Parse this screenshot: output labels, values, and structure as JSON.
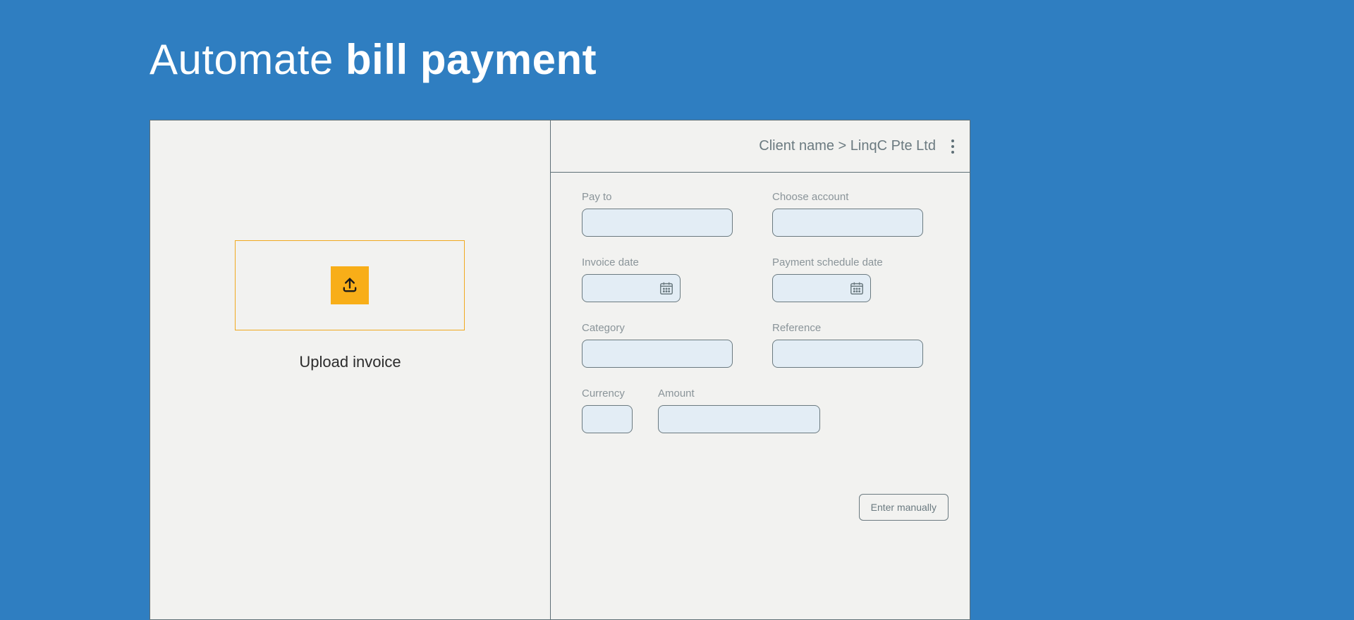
{
  "title": {
    "prefix": "Automate ",
    "bold": "bill payment"
  },
  "left": {
    "upload_label": "Upload invoice"
  },
  "header": {
    "breadcrumb_label": "Client name",
    "breadcrumb_sep": ">",
    "breadcrumb_value": "LinqC Pte Ltd"
  },
  "fields": {
    "pay_to": "Pay to",
    "choose_account": "Choose account",
    "invoice_date": "Invoice date",
    "payment_schedule_date": "Payment schedule date",
    "category": "Category",
    "reference": "Reference",
    "currency": "Currency",
    "amount": "Amount"
  },
  "actions": {
    "enter_manually": "Enter manually"
  },
  "colors": {
    "background": "#2f7ec1",
    "panel_bg": "#f2f2f0",
    "panel_border": "#5e6f76",
    "accent": "#f8ae18",
    "input_bg": "#e3edf5",
    "label": "#8a9499"
  }
}
